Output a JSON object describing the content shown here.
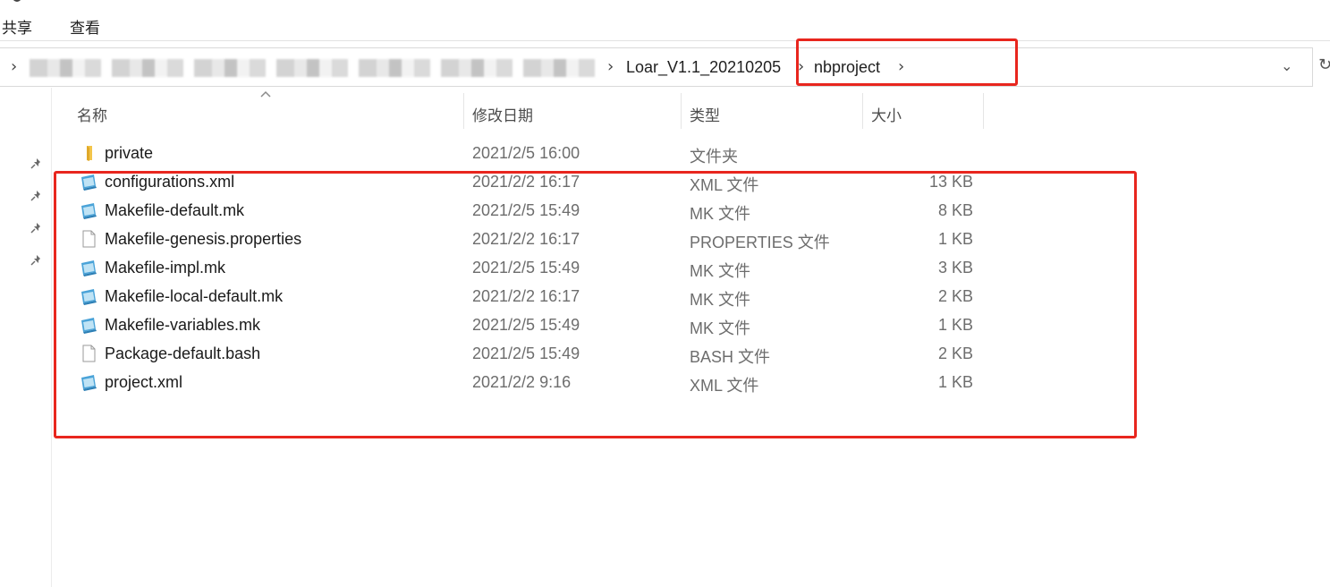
{
  "ribbon": {
    "tabs": [
      {
        "label": "共享"
      },
      {
        "label": "查看"
      }
    ]
  },
  "address_bar": {
    "crumbs": [
      {
        "label": "Loar_V1.1_20210205"
      },
      {
        "label": "nbproject"
      }
    ]
  },
  "columns": {
    "name": "名称",
    "date": "修改日期",
    "type": "类型",
    "size": "大小"
  },
  "files": [
    {
      "name": "private",
      "date": "2021/2/5 16:00",
      "type": "文件夹",
      "size": "",
      "icon": "folder-icon"
    },
    {
      "name": "configurations.xml",
      "date": "2021/2/2 16:17",
      "type": "XML 文件",
      "size": "13 KB",
      "icon": "xml-file-icon"
    },
    {
      "name": "Makefile-default.mk",
      "date": "2021/2/5 15:49",
      "type": "MK 文件",
      "size": "8 KB",
      "icon": "mk-file-icon"
    },
    {
      "name": "Makefile-genesis.properties",
      "date": "2021/2/2 16:17",
      "type": "PROPERTIES 文件",
      "size": "1 KB",
      "icon": "blank-file-icon"
    },
    {
      "name": "Makefile-impl.mk",
      "date": "2021/2/5 15:49",
      "type": "MK 文件",
      "size": "3 KB",
      "icon": "mk-file-icon"
    },
    {
      "name": "Makefile-local-default.mk",
      "date": "2021/2/2 16:17",
      "type": "MK 文件",
      "size": "2 KB",
      "icon": "mk-file-icon"
    },
    {
      "name": "Makefile-variables.mk",
      "date": "2021/2/5 15:49",
      "type": "MK 文件",
      "size": "1 KB",
      "icon": "mk-file-icon"
    },
    {
      "name": "Package-default.bash",
      "date": "2021/2/5 15:49",
      "type": "BASH 文件",
      "size": "2 KB",
      "icon": "blank-file-icon"
    },
    {
      "name": "project.xml",
      "date": "2021/2/2 9:16",
      "type": "XML 文件",
      "size": "1 KB",
      "icon": "xml-file-icon"
    }
  ],
  "colors": {
    "highlight": "#e8261e",
    "folder": "#f3c54a",
    "doc_icon": "#4aa3d8"
  }
}
